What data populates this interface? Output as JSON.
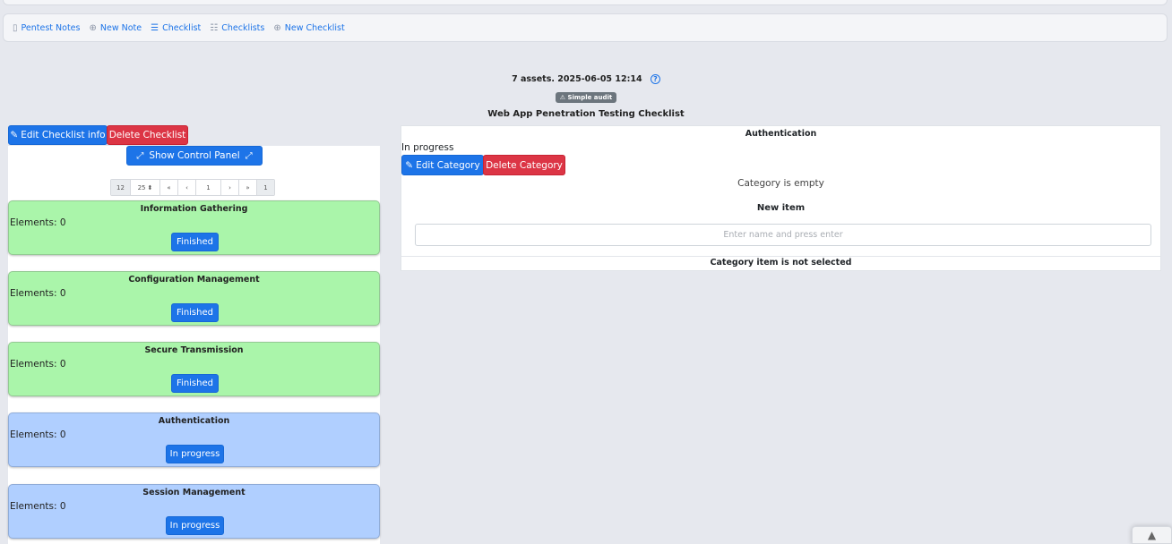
{
  "nav": {
    "items": [
      {
        "label": "Pentest Notes",
        "icon": "note-icon"
      },
      {
        "label": "New Note",
        "icon": "plus-circle-icon"
      },
      {
        "label": "Checklist",
        "icon": "list-check-icon"
      },
      {
        "label": "Checklists",
        "icon": "list-icon"
      },
      {
        "label": "New Checklist",
        "icon": "plus-circle-icon"
      }
    ]
  },
  "header": {
    "meta": "7 assets. 2025-06-05 12:14",
    "badge": "Simple audit",
    "title": "Web App Penetration Testing Checklist"
  },
  "left": {
    "edit_checklist": "Edit Checklist info",
    "delete_checklist": "Delete Checklist",
    "show_control_panel": "Show Control Panel",
    "pager": {
      "total": "12",
      "page_size": "25",
      "first": "«",
      "prev": "‹",
      "page": "1",
      "next": "›",
      "last": "»",
      "pages": "1"
    },
    "categories": [
      {
        "title": "Information Gathering",
        "elements": "Elements: 0",
        "status": "Finished",
        "color": "#aaf5aa"
      },
      {
        "title": "Configuration Management",
        "elements": "Elements: 0",
        "status": "Finished",
        "color": "#aaf5aa"
      },
      {
        "title": "Secure Transmission",
        "elements": "Elements: 0",
        "status": "Finished",
        "color": "#aaf5aa"
      },
      {
        "title": "Authentication",
        "elements": "Elements: 0",
        "status": "In progress",
        "color": "#b0cfff"
      },
      {
        "title": "Session Management",
        "elements": "Elements: 0",
        "status": "In progress",
        "color": "#b0cfff"
      }
    ]
  },
  "right": {
    "title": "Authentication",
    "status": "In progress",
    "edit_category": "Edit Category",
    "delete_category": "Delete Category",
    "empty_text": "Category is empty",
    "new_item_label": "New item",
    "new_item_placeholder": "Enter name and press enter",
    "not_selected": "Category item is not selected"
  },
  "colors": {
    "primary": "#1d74e8",
    "danger": "#dc3545",
    "finished": "#aaf5aa",
    "in_progress": "#b0cfff"
  }
}
